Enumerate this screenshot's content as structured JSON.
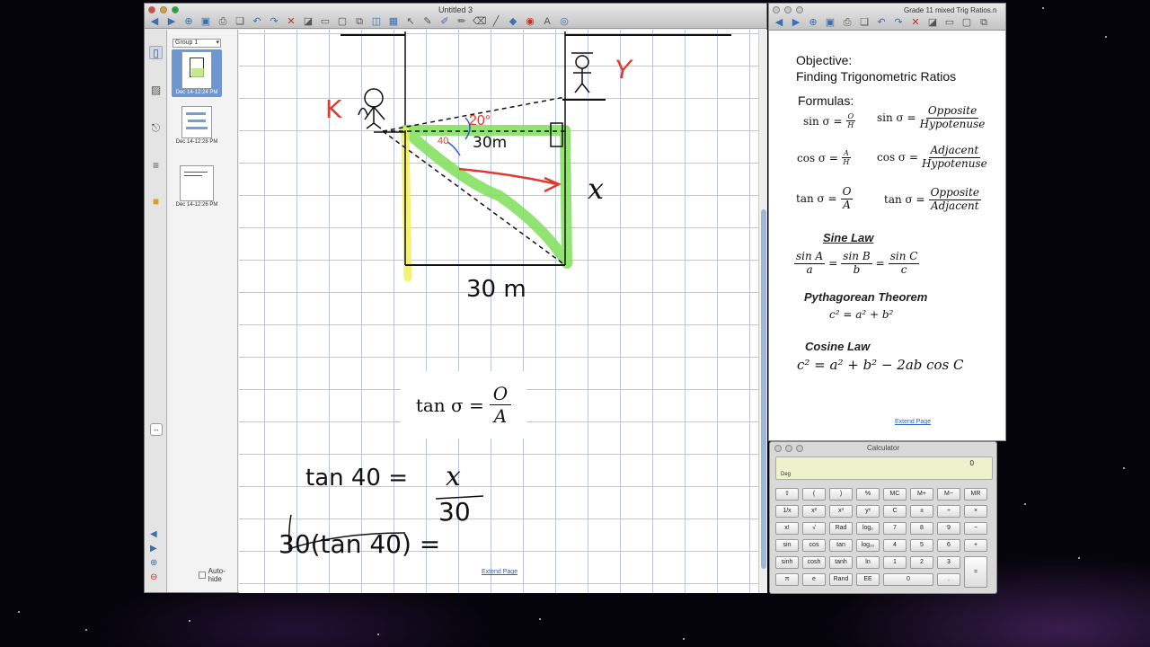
{
  "main_window": {
    "title": "Untitled 3",
    "sorter": {
      "group": "Group 1",
      "pages": [
        {
          "caption": "Dec 14-12:24 PM",
          "selected": true
        },
        {
          "caption": "Dec 14-12:28 PM",
          "selected": false
        },
        {
          "caption": "Dec 14-12:26 PM",
          "selected": false
        }
      ],
      "autohide_label": "Auto-hide"
    },
    "canvas": {
      "handwriting": {
        "label_k": "K",
        "label_y": "Y",
        "label_x": "x",
        "angle_20": "20°",
        "angle_40": "40",
        "side_30m_top": "30m",
        "bottom_30m": "30 m",
        "eq_left": "tan 40 =",
        "eq_num": "x",
        "eq_den": "30",
        "eq2": "30(tan 40) ="
      },
      "formula": {
        "lhs": "tan σ =",
        "num": "O",
        "den": "A"
      },
      "extend_link": "Extend Page"
    }
  },
  "notes_window": {
    "title": "Grade 11 mixed Trig Ratios.n",
    "objective_label": "Objective:",
    "objective_text": "Finding Trigonometric Ratios",
    "formulas_label": "Formulas:",
    "sin_short": {
      "lhs": "sin σ =",
      "num": "O",
      "den": "H"
    },
    "sin_long": {
      "lhs": "sin σ =",
      "num": "Opposite",
      "den": "Hypotenuse"
    },
    "cos_short": {
      "lhs": "cos σ =",
      "num": "A",
      "den": "H"
    },
    "cos_long": {
      "lhs": "cos σ =",
      "num": "Adjacent",
      "den": "Hypotenuse"
    },
    "tan_short": {
      "lhs": "tan σ =",
      "num": "O",
      "den": "A"
    },
    "tan_long": {
      "lhs": "tan σ =",
      "num": "Opposite",
      "den": "Adjacent"
    },
    "sine_law_heading": "Sine Law",
    "sine_law": {
      "n1": "sin A",
      "d1": "a",
      "n2": "sin B",
      "d2": "b",
      "n3": "sin C",
      "d3": "c"
    },
    "pythagorean_heading": "Pythagorean Theorem",
    "pythagorean": "c² = a² + b²",
    "cosine_law_heading": "Cosine Law",
    "cosine_law": "c² = a² + b² − 2ab cos C",
    "extend_link": "Extend Page"
  },
  "calculator": {
    "title": "Calculator",
    "display": "0",
    "mode": "Deg",
    "keys": [
      [
        "⇧",
        "(",
        ")",
        "%",
        "MC",
        "M+",
        "M−",
        "MR"
      ],
      [
        "1/x",
        "x²",
        "x³",
        "yˣ",
        "C",
        "±",
        "÷",
        "×"
      ],
      [
        "x!",
        "√",
        "Rad",
        "log₂",
        "7",
        "8",
        "9",
        "−"
      ],
      [
        "sin",
        "cos",
        "tan",
        "log₁₀",
        "4",
        "5",
        "6",
        "+"
      ],
      [
        "sinh",
        "cosh",
        "tanh",
        "ln",
        "1",
        "2",
        "3",
        "="
      ],
      [
        "π",
        "e",
        "Rand",
        "EE",
        "0",
        "."
      ]
    ]
  }
}
